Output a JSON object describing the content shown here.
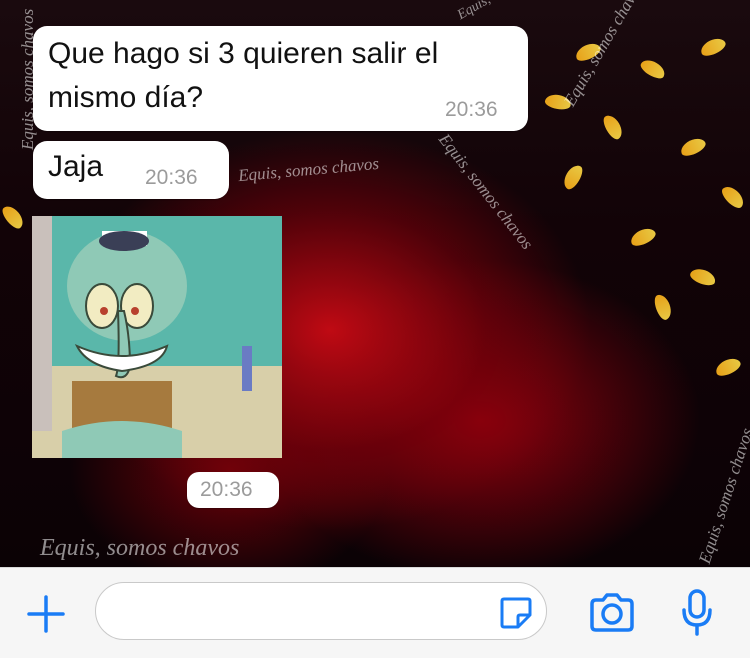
{
  "wallpaper": {
    "watermarks": [
      "Equis, somos chavos",
      "Equis, somos chavos",
      "Equis, somos chavos",
      "Equis, somos chavos",
      "Equis, somos chavos",
      "Equis, somos chavos",
      "Equis, somos chavos"
    ]
  },
  "messages": [
    {
      "text_line1": "Que hago si 3 quieren salir el",
      "text_line2": "mismo día?",
      "time": "20:36"
    },
    {
      "text": "Jaja",
      "time": "20:36"
    },
    {
      "time": "20:36"
    }
  ],
  "colors": {
    "accent": "#1a7cf5",
    "bubble": "#ffffff",
    "time_text": "#9b9b9b"
  },
  "input_bar": {
    "add_icon": "plus-icon",
    "sticker_icon": "sticker-icon",
    "camera_icon": "camera-icon",
    "mic_icon": "microphone-icon",
    "field_value": ""
  }
}
